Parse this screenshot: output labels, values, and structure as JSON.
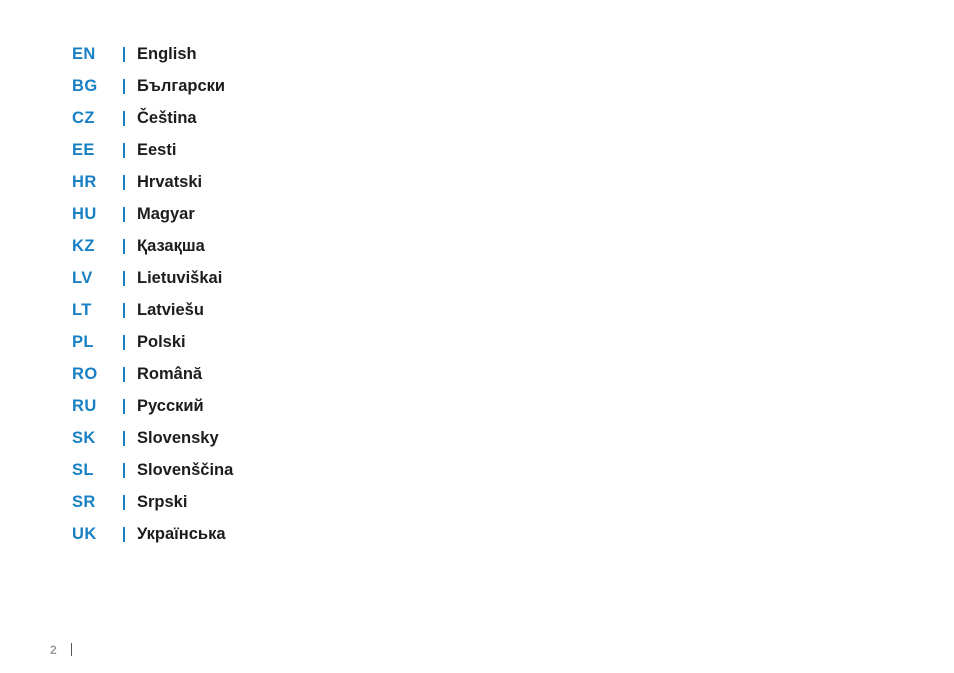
{
  "document": {
    "type": "language-selection-page",
    "background_color": "#ffffff",
    "accent_color": "#1a80c4",
    "text_color": "#1d1d1b",
    "footer_color": "#9b9b9b"
  },
  "language_list": {
    "separator_glyph": "|",
    "rows": [
      {
        "code": "EN",
        "name": "English"
      },
      {
        "code": "BG",
        "name": "Български"
      },
      {
        "code": "CZ",
        "name": "Čeština"
      },
      {
        "code": "EE",
        "name": "Eesti"
      },
      {
        "code": "HR",
        "name": "Hrvatski"
      },
      {
        "code": "HU",
        "name": "Magyar"
      },
      {
        "code": "KZ",
        "name": "Қазақша"
      },
      {
        "code": "LV",
        "name": "Lietuviškai"
      },
      {
        "code": "LT",
        "name": "Latviešu"
      },
      {
        "code": "PL",
        "name": "Polski"
      },
      {
        "code": "RO",
        "name": "Română"
      },
      {
        "code": "RU",
        "name": "Русский"
      },
      {
        "code": "SK",
        "name": "Slovensky"
      },
      {
        "code": "SL",
        "name": "Slovenščina"
      },
      {
        "code": "SR",
        "name": "Srpski"
      },
      {
        "code": "UK",
        "name": "Українська"
      }
    ]
  },
  "footer": {
    "page_number": "2"
  }
}
